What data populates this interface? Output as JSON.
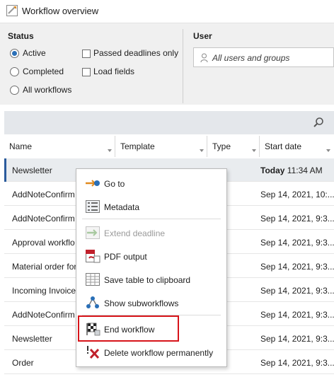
{
  "window": {
    "title": "Workflow overview",
    "icon": "workflow-window-icon"
  },
  "filter": {
    "status_label": "Status",
    "user_label": "User",
    "radios": [
      {
        "label": "Active",
        "selected": true
      },
      {
        "label": "Completed",
        "selected": false
      },
      {
        "label": "All workflows",
        "selected": false
      }
    ],
    "checkboxes": [
      {
        "label": "Passed deadlines only",
        "checked": false
      },
      {
        "label": "Load fields",
        "checked": false
      }
    ],
    "user_placeholder": "All users and groups"
  },
  "table": {
    "columns": [
      "Name",
      "Template",
      "Type",
      "Start date"
    ],
    "rows": [
      {
        "name": "Newsletter",
        "date_prefix": "Today",
        "date": " 11:34 AM",
        "selected": true
      },
      {
        "name": "AddNoteConfirm",
        "date_prefix": "",
        "date": "Sep 14, 2021, 10:..."
      },
      {
        "name": "AddNoteConfirm",
        "date_prefix": "",
        "date": "Sep 14, 2021, 9:3..."
      },
      {
        "name": "Approval workflo",
        "date_prefix": "",
        "date": "Sep 14, 2021, 9:3..."
      },
      {
        "name": "Material order for",
        "date_prefix": "",
        "date": "Sep 14, 2021, 9:3..."
      },
      {
        "name": "Incoming Invoice",
        "date_prefix": "",
        "date": "Sep 14, 2021, 9:3..."
      },
      {
        "name": "AddNoteConfirm",
        "date_prefix": "",
        "date": "Sep 14, 2021, 9:3..."
      },
      {
        "name": "Newsletter",
        "date_prefix": "",
        "date": "Sep 14, 2021, 9:3..."
      },
      {
        "name": "Order",
        "date_prefix": "",
        "date": "Sep 14, 2021, 9:3..."
      }
    ]
  },
  "context_menu": {
    "items": [
      {
        "label": "Go to",
        "icon": "goto-arrow-icon",
        "enabled": true
      },
      {
        "label": "Metadata",
        "icon": "metadata-icon",
        "enabled": true
      },
      {
        "label": "Extend deadline",
        "icon": "extend-deadline-icon",
        "enabled": false
      },
      {
        "label": "PDF output",
        "icon": "pdf-icon",
        "enabled": true
      },
      {
        "label": "Save table to clipboard",
        "icon": "table-clipboard-icon",
        "enabled": true
      },
      {
        "label": "Show subworkflows",
        "icon": "subworkflows-icon",
        "enabled": true
      },
      {
        "label": "End workflow",
        "icon": "end-workflow-flag-icon",
        "enabled": true,
        "highlighted": true
      },
      {
        "label": "Delete workflow permanently",
        "icon": "delete-x-icon",
        "enabled": true
      }
    ]
  },
  "colors": {
    "accent": "#2a6fb7",
    "highlight_border": "#d7141a",
    "toolbar": "#e4e7eb",
    "filter_bg": "#f0f0f0"
  }
}
